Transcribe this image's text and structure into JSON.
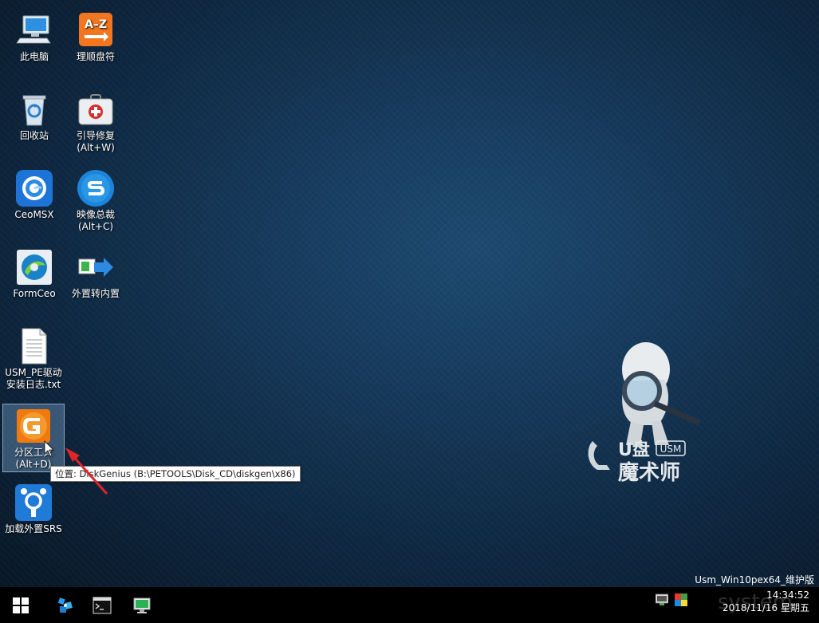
{
  "desktop": {
    "icons": [
      {
        "id": "this-pc",
        "label": "此电脑"
      },
      {
        "id": "sort-drive",
        "label": "理顺盘符"
      },
      {
        "id": "recycle-bin",
        "label": "回收站"
      },
      {
        "id": "boot-repair",
        "label": "引导修复\n(Alt+W)"
      },
      {
        "id": "ceomsx",
        "label": "CeoMSX"
      },
      {
        "id": "image-master",
        "label": "映像总裁\n(Alt+C)"
      },
      {
        "id": "formceo",
        "label": "FormCeo"
      },
      {
        "id": "ext-to-int",
        "label": "外置转内置"
      },
      {
        "id": "driver-log",
        "label": "USM_PE驱动\n安装日志.txt"
      },
      {
        "id": "partition-tool",
        "label": "分区工具\n(Alt+D)"
      },
      {
        "id": "load-srs",
        "label": "加载外置SRS"
      }
    ],
    "tooltip": "位置: DiskGenius (B:\\PETOOLS\\Disk_CD\\diskgen\\x86)",
    "version_text": "Usm_Win10pex64_维护版",
    "mascot": {
      "line1": "U盘",
      "badge": "USM",
      "line2": "魔术师"
    },
    "az_glyph": "A–Z",
    "colors": {
      "accent": "#1e6fd9"
    }
  },
  "taskbar": {
    "start_icon": "windows-logo-icon",
    "apps": [
      "network-tool-icon",
      "cmd-console-icon",
      "pc-monitor-icon"
    ],
    "time": "14:34:52",
    "date": "2018/11/16 星期五",
    "watermark": "system"
  }
}
